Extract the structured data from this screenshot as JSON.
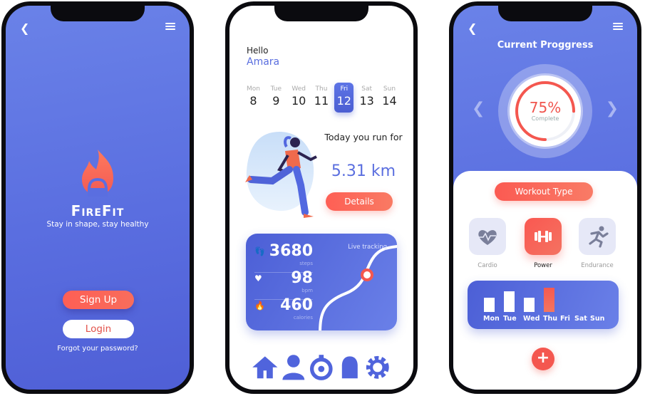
{
  "login_screen": {
    "brand": "FireFit",
    "tagline": "Stay in shape, stay healthy",
    "signup_label": "Sign Up",
    "login_label": "Login",
    "forgot_label": "Forgot your password?",
    "back_icon": "chevron-left-icon",
    "menu_icon": "hamburger-icon"
  },
  "home_screen": {
    "greeting": "Hello",
    "user_name": "Amara",
    "days": [
      {
        "name": "Mon",
        "date": "8"
      },
      {
        "name": "Tue",
        "date": "9"
      },
      {
        "name": "Wed",
        "date": "10"
      },
      {
        "name": "Thu",
        "date": "11"
      },
      {
        "name": "Fri",
        "date": "12",
        "selected": true
      },
      {
        "name": "Sat",
        "date": "13"
      },
      {
        "name": "Sun",
        "date": "14"
      }
    ],
    "run_title": "Today you run for",
    "run_distance": "5.31 km",
    "details_label": "Details",
    "stats": {
      "steps_value": "3680",
      "steps_unit": "steps",
      "bpm_value": "98",
      "bpm_unit": "bpm",
      "calories_value": "460",
      "calories_unit": "calories",
      "live_label": "Live tracking"
    },
    "nav": [
      "home-icon",
      "user-icon",
      "stopwatch-icon",
      "bell-icon",
      "gear-icon"
    ],
    "accent": "#5a6edf",
    "action_color": "#fe5f55"
  },
  "progress_screen": {
    "title": "Current Proggress",
    "percent": "75%",
    "percent_value": 0.75,
    "complete_label": "Complete",
    "workout_type_label": "Workout Type",
    "workout_types": [
      {
        "label": "Cardio",
        "icon": "heart-pulse-icon"
      },
      {
        "label": "Power",
        "icon": "dumbbell-icon",
        "selected": true
      },
      {
        "label": "Endurance",
        "icon": "running-icon"
      }
    ],
    "week_days": [
      "Mon",
      "Tue",
      "Wed",
      "Thu",
      "Fri",
      "Sat",
      "Sun"
    ],
    "week_values": [
      0.6,
      0.85,
      0.58,
      1.0,
      0,
      0,
      0
    ],
    "highlight_day": "Thu",
    "add_label": "+"
  }
}
